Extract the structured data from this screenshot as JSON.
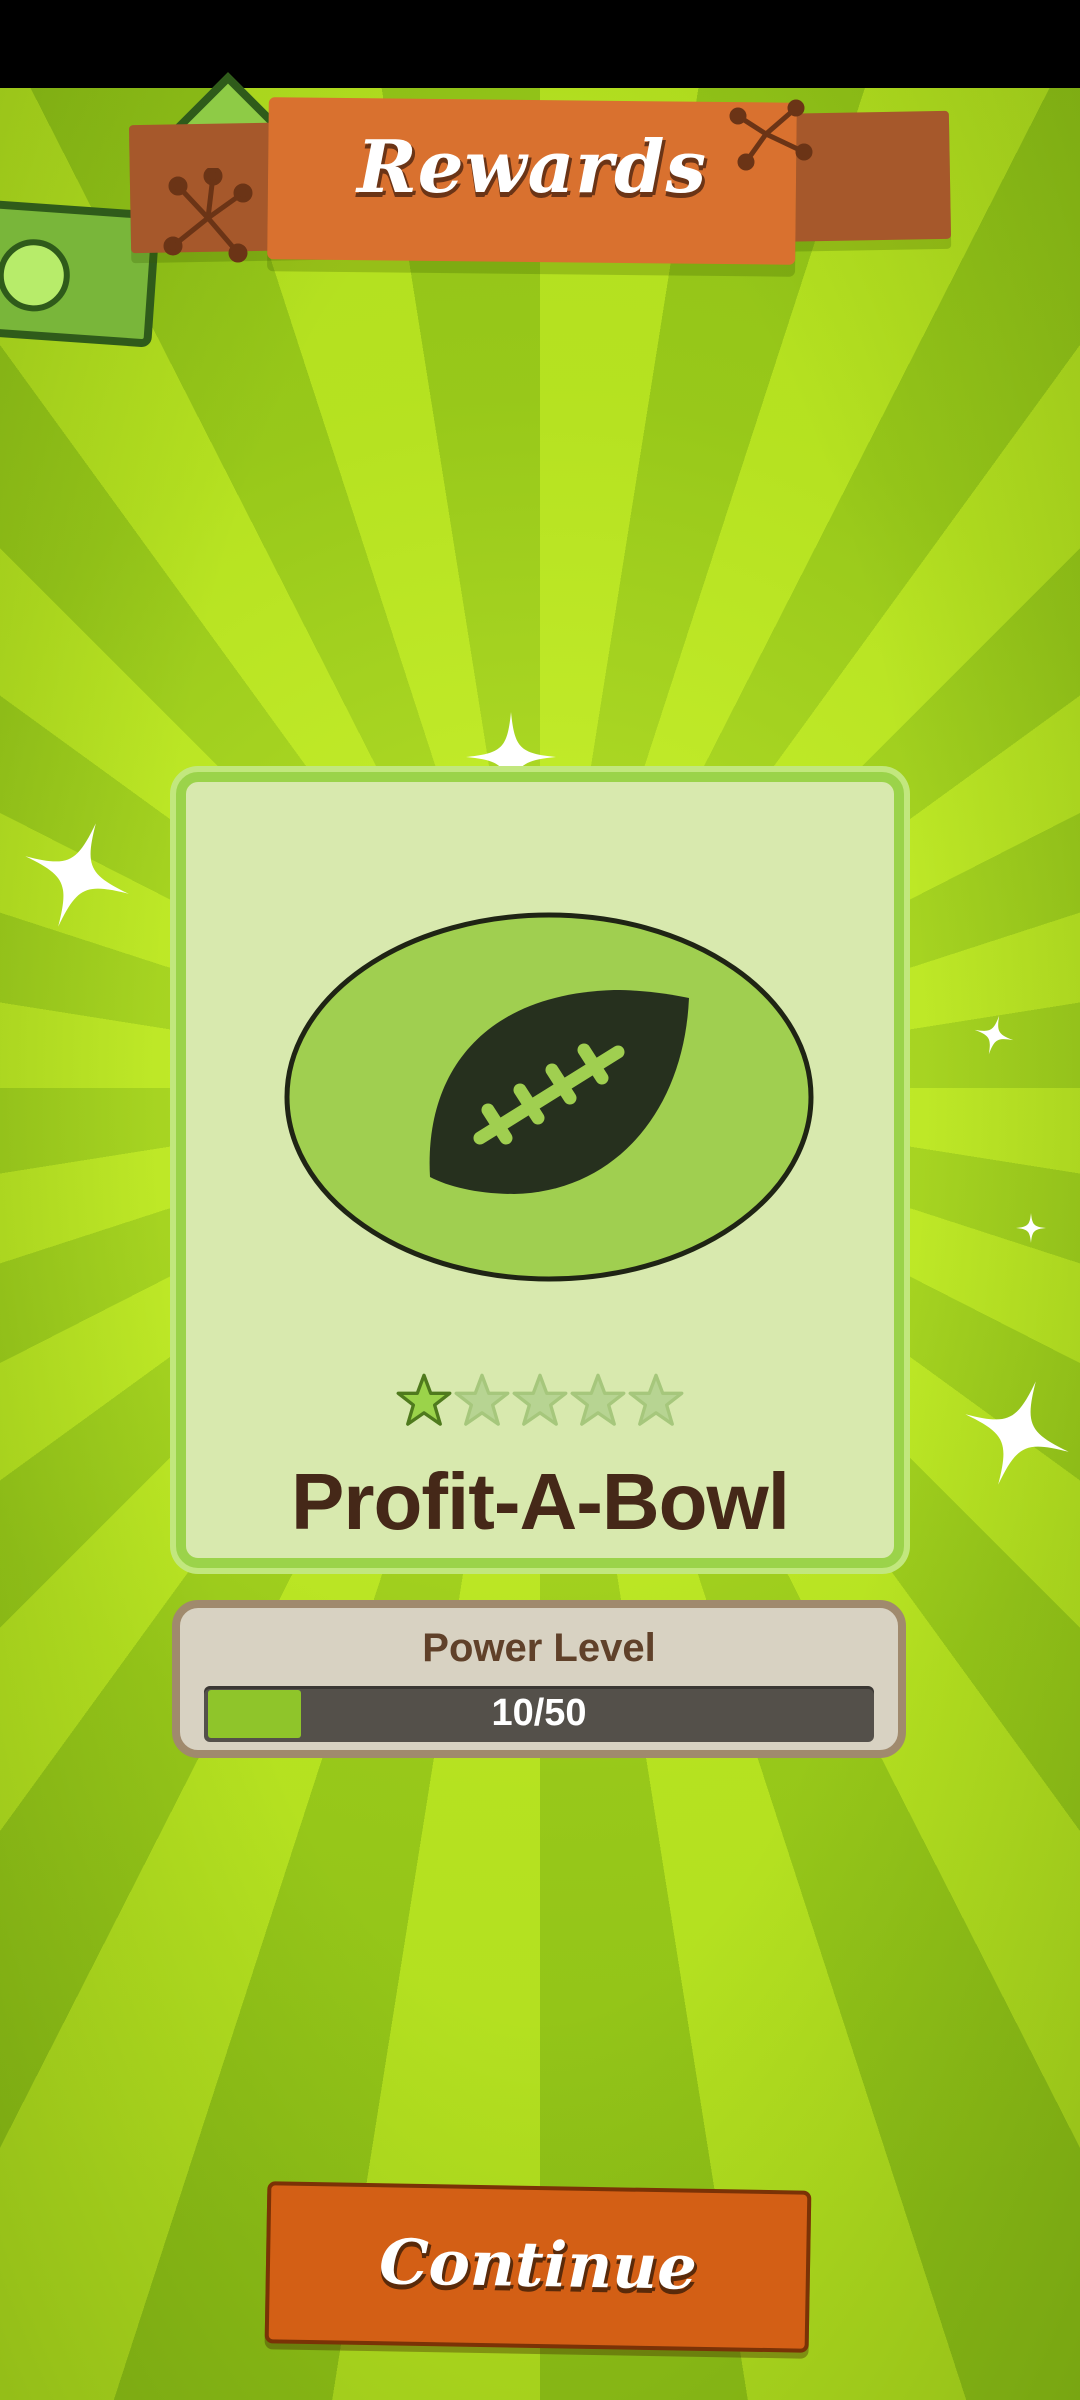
{
  "header": {
    "title": "Rewards"
  },
  "reward": {
    "name": "Profit-A-Bowl",
    "icon": "football-icon",
    "stars_total": 5,
    "stars_filled": 1
  },
  "power": {
    "label": "Power Level",
    "value_text": "10/50",
    "current": 10,
    "max": 50
  },
  "actions": {
    "continue_label": "Continue"
  },
  "colors": {
    "banner": "#d9712f",
    "button": "#d35f15",
    "progress_fill": "#8fc52a",
    "title_text": "#452818"
  }
}
